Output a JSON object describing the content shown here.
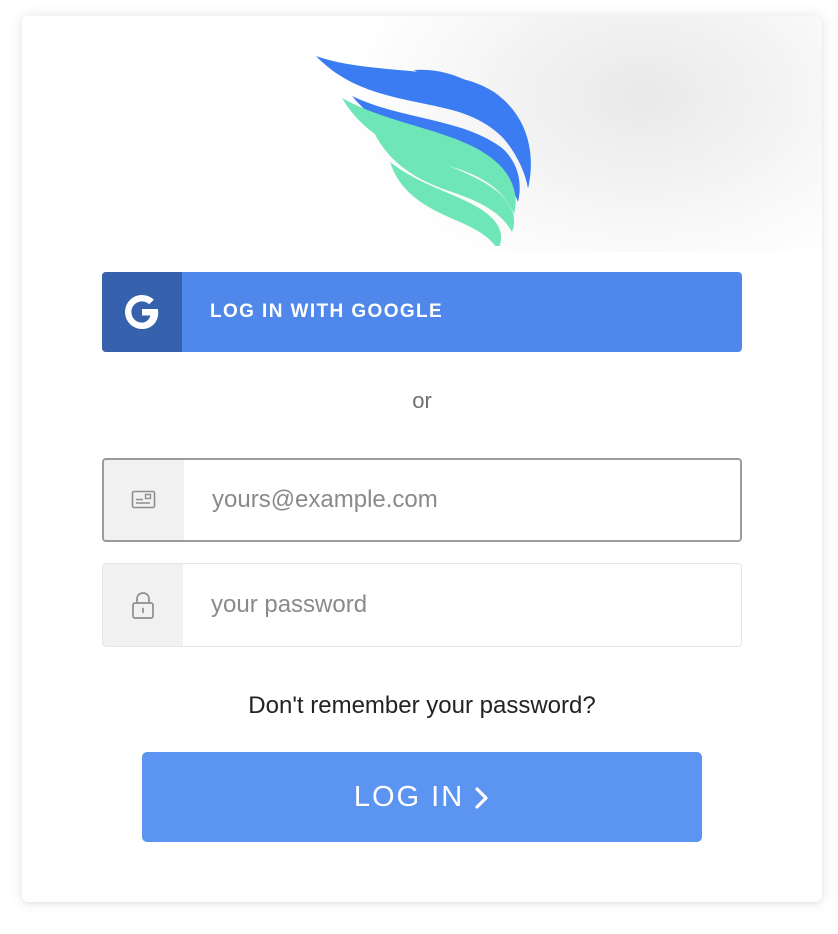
{
  "colors": {
    "google_button": "#4f88ea",
    "google_icon_box": "#3661ad",
    "login_button": "#5b94f1",
    "logo_blue": "#3b7cf3",
    "logo_green": "#6ee6b8"
  },
  "icons": {
    "logo": "brand-wing-logo",
    "google": "google-g-icon",
    "email": "envelope-icon",
    "password": "lock-icon",
    "login_arrow": "chevron-right-icon"
  },
  "google_login": {
    "label": "LOG IN WITH GOOGLE"
  },
  "divider": {
    "text": "or"
  },
  "email_field": {
    "value": "",
    "placeholder": "yours@example.com"
  },
  "password_field": {
    "value": "",
    "placeholder": "your password"
  },
  "forgot_password": {
    "label": "Don't remember your password?"
  },
  "login_button": {
    "label": "LOG IN"
  }
}
